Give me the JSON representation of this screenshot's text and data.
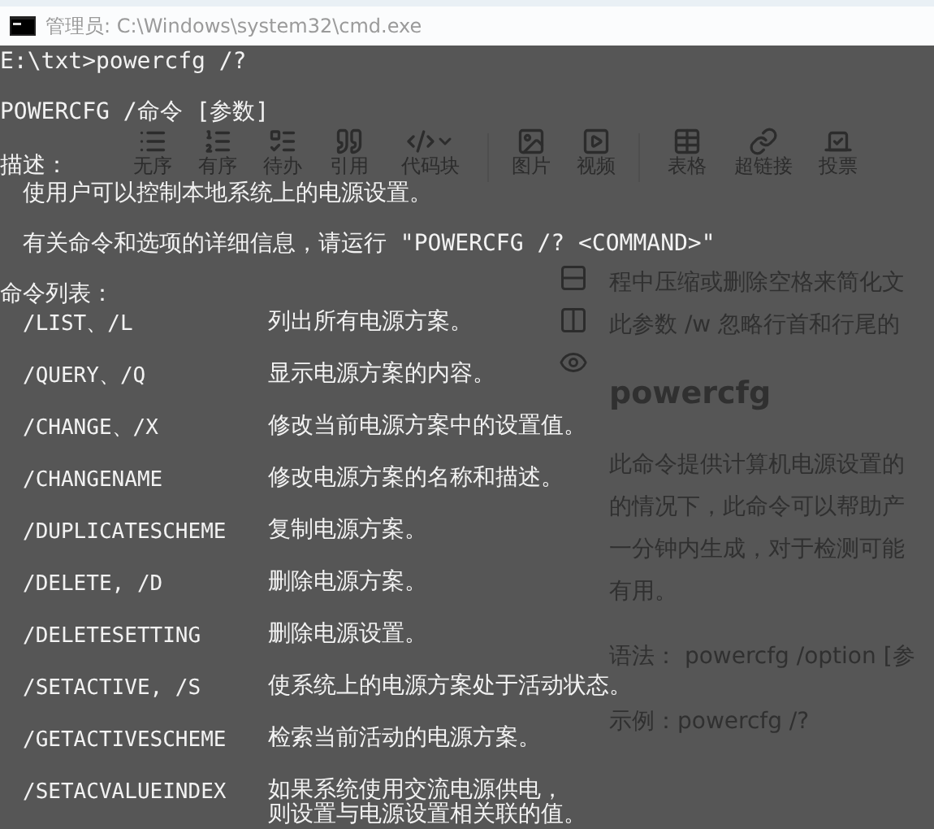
{
  "window": {
    "title": "管理员: C:\\Windows\\system32\\cmd.exe"
  },
  "editor": {
    "toolbar": [
      {
        "label": "无序"
      },
      {
        "label": "有序"
      },
      {
        "label": "待办"
      },
      {
        "label": "引用"
      },
      {
        "label": "代码块"
      },
      {
        "label": "图片"
      },
      {
        "label": "视频"
      },
      {
        "label": "表格"
      },
      {
        "label": "超链接"
      },
      {
        "label": "投票"
      }
    ],
    "article": {
      "intro": [
        "程中压缩或删除空格来简化文",
        "此参数 /w 忽略行首和行尾的"
      ],
      "heading": "powercfg",
      "body": [
        "此命令提供计算机电源设置的",
        "的情况下，此命令可以帮助产",
        "一分钟内生成，对于检测可能",
        "有用。"
      ],
      "syntax": "语法：  powercfg /option [参",
      "example": "示例：powercfg /?"
    }
  },
  "console": {
    "prompt": "E:\\txt>powercfg /?",
    "usage": "POWERCFG /命令 [参数]",
    "description_label": "描述：",
    "description": "使用户可以控制本地系统上的电源设置。",
    "help_hint": "有关命令和选项的详细信息，请运行 \"POWERCFG /? <COMMAND>\"",
    "list_label": "命令列表：",
    "commands": [
      {
        "name": "/LIST、/L",
        "description": [
          "列出所有电源方案。"
        ]
      },
      {
        "name": "/QUERY、/Q",
        "description": [
          "显示电源方案的内容。"
        ]
      },
      {
        "name": "/CHANGE、/X",
        "description": [
          "修改当前电源方案中的设置值。"
        ]
      },
      {
        "name": "/CHANGENAME",
        "description": [
          "修改电源方案的名称和描述。"
        ]
      },
      {
        "name": "/DUPLICATESCHEME",
        "description": [
          "复制电源方案。"
        ]
      },
      {
        "name": "/DELETE, /D",
        "description": [
          "删除电源方案。"
        ]
      },
      {
        "name": "/DELETESETTING",
        "description": [
          "删除电源设置。"
        ]
      },
      {
        "name": "/SETACTIVE, /S",
        "description": [
          "使系统上的电源方案处于活动状态。"
        ]
      },
      {
        "name": "/GETACTIVESCHEME",
        "description": [
          "检索当前活动的电源方案。"
        ]
      },
      {
        "name": "/SETACVALUEINDEX",
        "description": [
          "如果系统使用交流电源供电，",
          "则设置与电源设置相关联的值。"
        ]
      }
    ]
  }
}
